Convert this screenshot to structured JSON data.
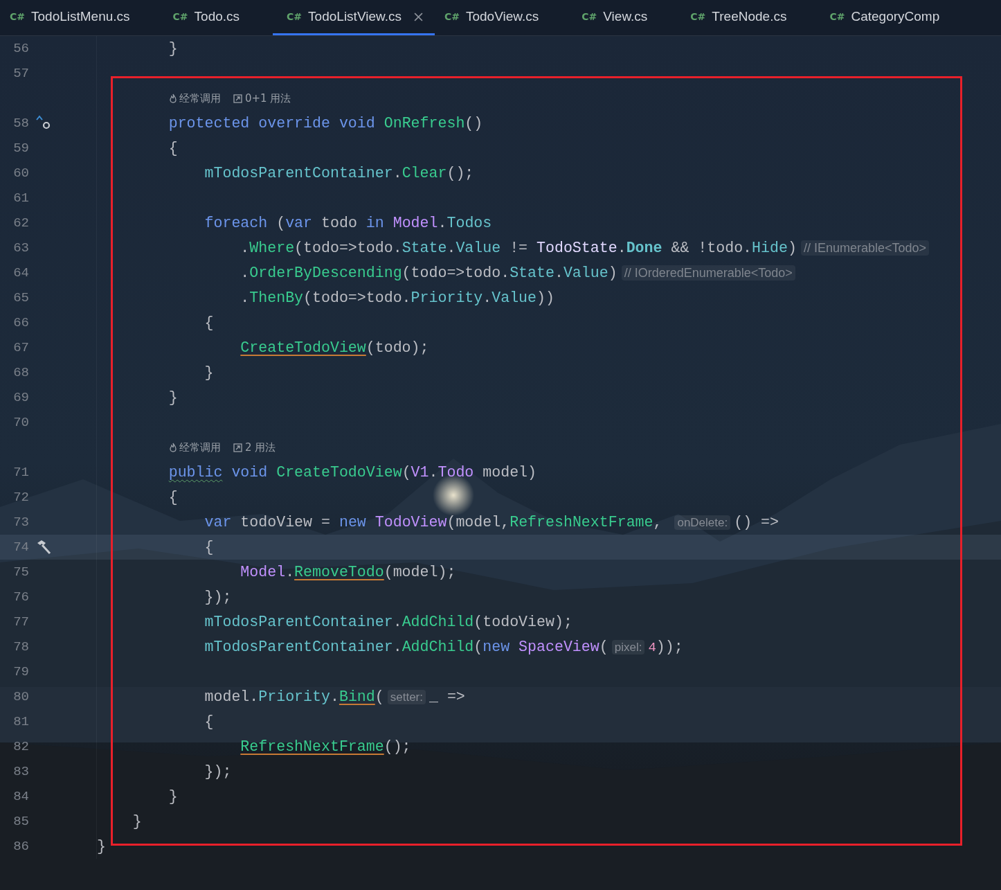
{
  "tabs": [
    {
      "file_type": "C#",
      "label": "TodoListMenu.cs",
      "selected": false
    },
    {
      "file_type": "C#",
      "label": "Todo.cs",
      "selected": false
    },
    {
      "file_type": "C#",
      "label": "TodoListView.cs",
      "selected": true
    },
    {
      "file_type": "C#",
      "label": "TodoView.cs",
      "selected": false
    },
    {
      "file_type": "C#",
      "label": "View.cs",
      "selected": false
    },
    {
      "file_type": "C#",
      "label": "TreeNode.cs",
      "selected": false
    },
    {
      "file_type": "C#",
      "label": "CategoryComp",
      "selected": false
    }
  ],
  "lines": [
    {
      "kind": "code",
      "number": "56",
      "current": false,
      "tokens": [
        {
          "kind": "plain",
          "text": "        }"
        }
      ]
    },
    {
      "kind": "code",
      "number": "57",
      "current": false
    },
    {
      "kind": "lens",
      "frequency": "经常调用",
      "usages": "0+1 用法"
    },
    {
      "kind": "code",
      "number": "58",
      "current": false,
      "gutter": {
        "kind": "override"
      },
      "tokens": [
        {
          "kind": "kw",
          "text": "        protected"
        },
        {
          "kind": "kw",
          "text": " override"
        },
        {
          "kind": "kw",
          "text": " void"
        },
        {
          "kind": "fn",
          "text": " OnRefresh"
        },
        {
          "kind": "plain",
          "text": "()"
        }
      ]
    },
    {
      "kind": "code",
      "number": "59",
      "current": false,
      "tokens": [
        {
          "kind": "plain",
          "text": "        {"
        }
      ]
    },
    {
      "kind": "code",
      "number": "60",
      "current": false,
      "tokens": [
        {
          "kind": "field",
          "text": "            mTodosParentContainer"
        },
        {
          "kind": "plain",
          "text": "."
        },
        {
          "kind": "fn",
          "text": "Clear"
        },
        {
          "kind": "plain",
          "text": "();"
        }
      ]
    },
    {
      "kind": "code",
      "number": "61",
      "current": false
    },
    {
      "kind": "code",
      "number": "62",
      "current": false,
      "tokens": [
        {
          "kind": "kw",
          "text": "            foreach"
        },
        {
          "kind": "plain",
          "text": " ("
        },
        {
          "kind": "kw",
          "text": "var"
        },
        {
          "kind": "plain",
          "text": " todo "
        },
        {
          "kind": "kw",
          "text": "in"
        },
        {
          "kind": "type",
          "text": " Model"
        },
        {
          "kind": "plain",
          "text": "."
        },
        {
          "kind": "prop",
          "text": "Todos"
        }
      ]
    },
    {
      "kind": "code",
      "number": "63",
      "current": false,
      "tokens": [
        {
          "kind": "plain",
          "text": "                ."
        },
        {
          "kind": "fn",
          "text": "Where"
        },
        {
          "kind": "plain",
          "text": "(todo=>todo."
        },
        {
          "kind": "prop",
          "text": "State"
        },
        {
          "kind": "plain",
          "text": "."
        },
        {
          "kind": "prop",
          "text": "Value"
        },
        {
          "kind": "plain",
          "text": " != "
        },
        {
          "kind": "enum",
          "text": "TodoState"
        },
        {
          "kind": "plain",
          "text": "."
        },
        {
          "kind": "const",
          "text": "Done"
        },
        {
          "kind": "plain",
          "text": " && !todo."
        },
        {
          "kind": "prop",
          "text": "Hide"
        },
        {
          "kind": "plain",
          "text": ")"
        },
        {
          "kind": "comment",
          "text": "// IEnumerable<Todo>"
        }
      ]
    },
    {
      "kind": "code",
      "number": "64",
      "current": false,
      "tokens": [
        {
          "kind": "plain",
          "text": "                ."
        },
        {
          "kind": "fn",
          "text": "OrderByDescending"
        },
        {
          "kind": "plain",
          "text": "(todo=>todo."
        },
        {
          "kind": "prop",
          "text": "State"
        },
        {
          "kind": "plain",
          "text": "."
        },
        {
          "kind": "prop",
          "text": "Value"
        },
        {
          "kind": "plain",
          "text": ")"
        },
        {
          "kind": "comment",
          "text": "// IOrderedEnumerable<Todo>"
        }
      ]
    },
    {
      "kind": "code",
      "number": "65",
      "current": false,
      "tokens": [
        {
          "kind": "plain",
          "text": "                ."
        },
        {
          "kind": "fn",
          "text": "ThenBy"
        },
        {
          "kind": "plain",
          "text": "(todo=>todo."
        },
        {
          "kind": "prop",
          "text": "Priority"
        },
        {
          "kind": "plain",
          "text": "."
        },
        {
          "kind": "prop",
          "text": "Value"
        },
        {
          "kind": "plain",
          "text": "))"
        }
      ]
    },
    {
      "kind": "code",
      "number": "66",
      "current": false,
      "tokens": [
        {
          "kind": "plain",
          "text": "            {"
        }
      ]
    },
    {
      "kind": "code",
      "number": "67",
      "current": false,
      "tokens": [
        {
          "kind": "fnlink",
          "text": "                CreateTodoView"
        },
        {
          "kind": "plain",
          "text": "(todo);"
        }
      ]
    },
    {
      "kind": "code",
      "number": "68",
      "current": false,
      "tokens": [
        {
          "kind": "plain",
          "text": "            }"
        }
      ]
    },
    {
      "kind": "code",
      "number": "69",
      "current": false,
      "tokens": [
        {
          "kind": "plain",
          "text": "        }"
        }
      ]
    },
    {
      "kind": "code",
      "number": "70",
      "current": false
    },
    {
      "kind": "lens",
      "frequency": "经常调用",
      "usages": "2 用法"
    },
    {
      "kind": "code",
      "number": "71",
      "current": false,
      "tokens": [
        {
          "kind": "kwwarn",
          "text": "        public"
        },
        {
          "kind": "kw",
          "text": " void"
        },
        {
          "kind": "fn",
          "text": " CreateTodoView"
        },
        {
          "kind": "plain",
          "text": "("
        },
        {
          "kind": "type",
          "text": "V1"
        },
        {
          "kind": "plain",
          "text": "."
        },
        {
          "kind": "type",
          "text": "Todo"
        },
        {
          "kind": "plain",
          "text": " model)"
        }
      ]
    },
    {
      "kind": "code",
      "number": "72",
      "current": false,
      "tokens": [
        {
          "kind": "plain",
          "text": "        {"
        }
      ]
    },
    {
      "kind": "code",
      "number": "73",
      "current": false,
      "tokens": [
        {
          "kind": "kw",
          "text": "            var"
        },
        {
          "kind": "plain",
          "text": " todoView = "
        },
        {
          "kind": "kw",
          "text": "new"
        },
        {
          "kind": "type",
          "text": " TodoView"
        },
        {
          "kind": "plain",
          "text": "(model,"
        },
        {
          "kind": "fn",
          "text": "RefreshNextFrame"
        },
        {
          "kind": "plain",
          "text": ", "
        },
        {
          "kind": "hint",
          "text": "onDelete:"
        },
        {
          "kind": "plain",
          "text": "() =>"
        }
      ]
    },
    {
      "kind": "code",
      "number": "74",
      "current": true,
      "gutter": {
        "kind": "hammer"
      },
      "tokens": [
        {
          "kind": "plain",
          "text": "            {"
        }
      ]
    },
    {
      "kind": "code",
      "number": "75",
      "current": false,
      "tokens": [
        {
          "kind": "type",
          "text": "                Model"
        },
        {
          "kind": "plain",
          "text": "."
        },
        {
          "kind": "fnlink",
          "text": "RemoveTodo"
        },
        {
          "kind": "plain",
          "text": "(model);"
        }
      ]
    },
    {
      "kind": "code",
      "number": "76",
      "current": false,
      "tokens": [
        {
          "kind": "plain",
          "text": "            });"
        }
      ]
    },
    {
      "kind": "code",
      "number": "77",
      "current": false,
      "tokens": [
        {
          "kind": "field",
          "text": "            mTodosParentContainer"
        },
        {
          "kind": "plain",
          "text": "."
        },
        {
          "kind": "fn",
          "text": "AddChild"
        },
        {
          "kind": "plain",
          "text": "(todoView);"
        }
      ]
    },
    {
      "kind": "code",
      "number": "78",
      "current": false,
      "tokens": [
        {
          "kind": "field",
          "text": "            mTodosParentContainer"
        },
        {
          "kind": "plain",
          "text": "."
        },
        {
          "kind": "fn",
          "text": "AddChild"
        },
        {
          "kind": "plain",
          "text": "("
        },
        {
          "kind": "kw",
          "text": "new"
        },
        {
          "kind": "type",
          "text": " SpaceView"
        },
        {
          "kind": "plain",
          "text": "("
        },
        {
          "kind": "hint",
          "text": "pixel:"
        },
        {
          "kind": "num",
          "text": "4"
        },
        {
          "kind": "plain",
          "text": "));"
        }
      ]
    },
    {
      "kind": "code",
      "number": "79",
      "current": false
    },
    {
      "kind": "code",
      "number": "80",
      "current": false,
      "tokens": [
        {
          "kind": "plain",
          "text": "            model."
        },
        {
          "kind": "prop",
          "text": "Priority"
        },
        {
          "kind": "plain",
          "text": "."
        },
        {
          "kind": "fnlink",
          "text": "Bind"
        },
        {
          "kind": "plain",
          "text": "("
        },
        {
          "kind": "hint",
          "text": "setter:"
        },
        {
          "kind": "plain",
          "text": "_ =>"
        }
      ]
    },
    {
      "kind": "code",
      "number": "81",
      "current": false,
      "tokens": [
        {
          "kind": "plain",
          "text": "            {"
        }
      ]
    },
    {
      "kind": "code",
      "number": "82",
      "current": false,
      "tokens": [
        {
          "kind": "fnlink",
          "text": "                RefreshNextFrame"
        },
        {
          "kind": "plain",
          "text": "();"
        }
      ]
    },
    {
      "kind": "code",
      "number": "83",
      "current": false,
      "tokens": [
        {
          "kind": "plain",
          "text": "            });"
        }
      ]
    },
    {
      "kind": "code",
      "number": "84",
      "current": false,
      "tokens": [
        {
          "kind": "plain",
          "text": "        }"
        }
      ]
    },
    {
      "kind": "code",
      "number": "85",
      "current": false,
      "tokens": [
        {
          "kind": "plain",
          "text": "    }"
        }
      ]
    },
    {
      "kind": "code",
      "number": "86",
      "current": false,
      "tokens": [
        {
          "kind": "plain",
          "text": "}"
        }
      ]
    }
  ]
}
